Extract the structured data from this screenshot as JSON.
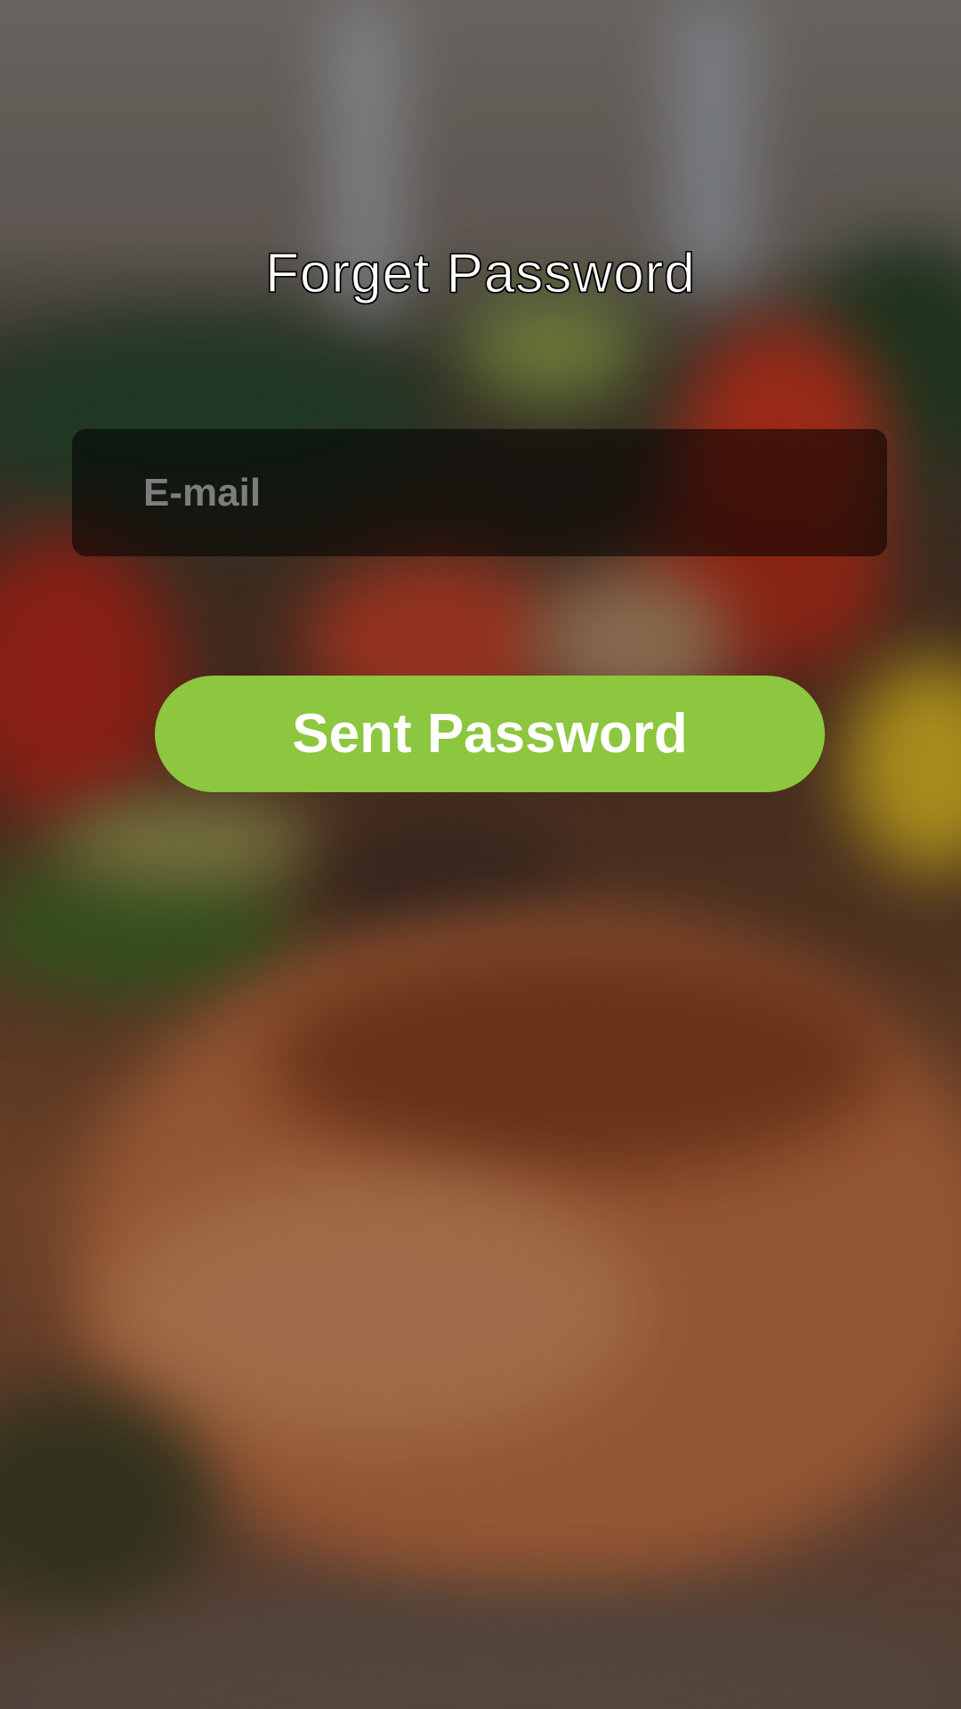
{
  "screen": {
    "title": "Forget Password"
  },
  "email": {
    "placeholder": "E-mail",
    "value": ""
  },
  "actions": {
    "send_label": "Sent Password"
  },
  "colors": {
    "accent": "#8dc63f",
    "field_bg": "rgba(0,0,0,0.55)",
    "placeholder": "#7d7d7d"
  }
}
